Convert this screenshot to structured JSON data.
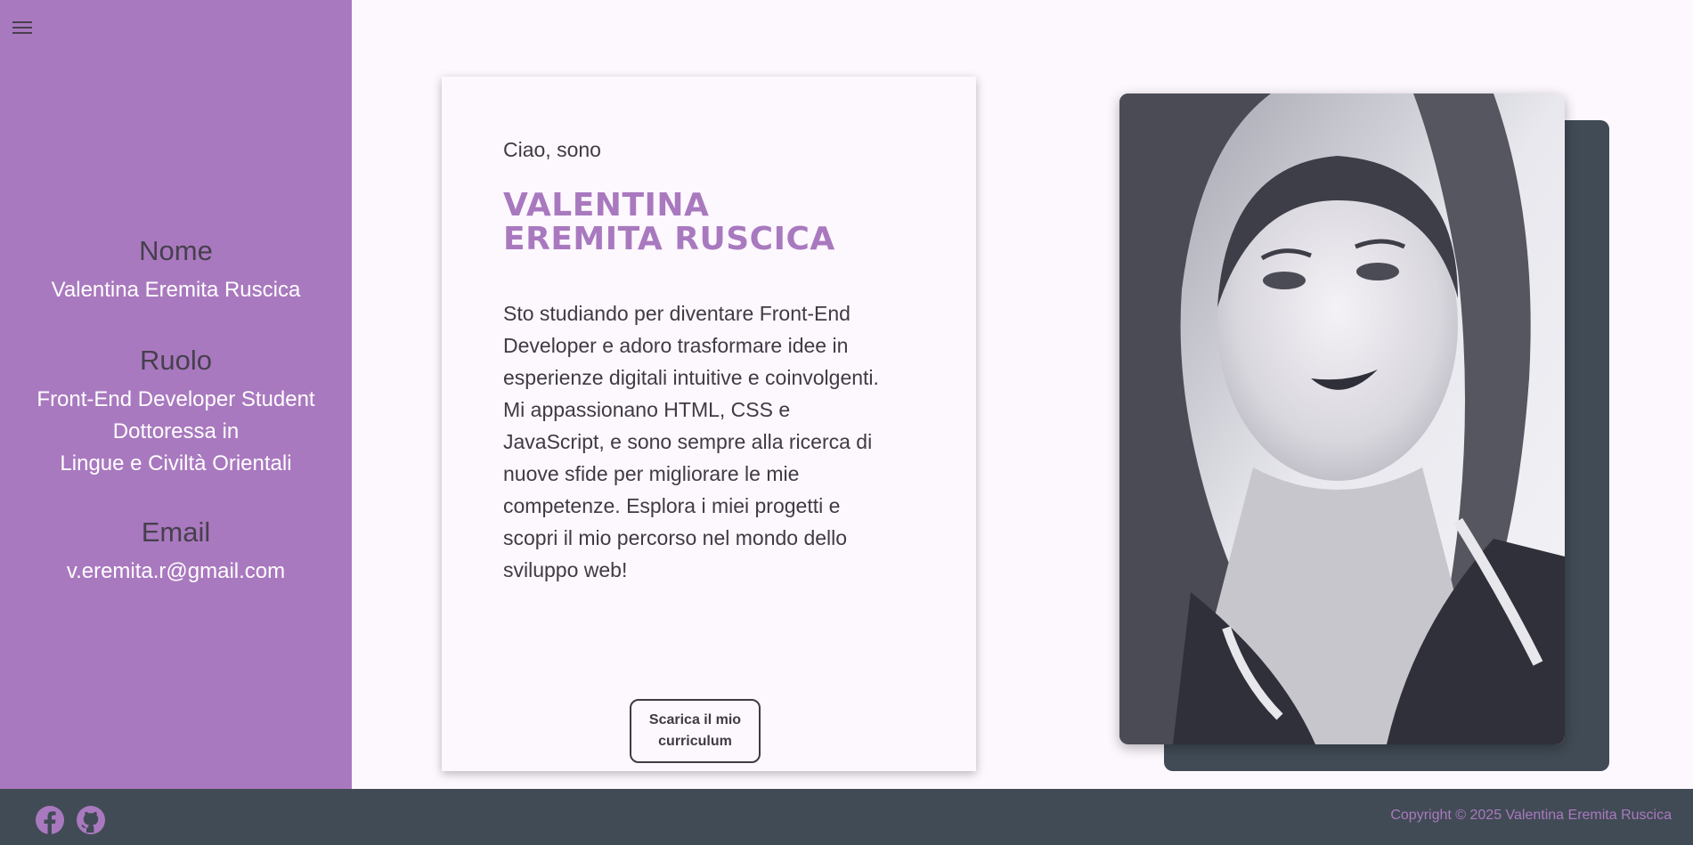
{
  "sidebar": {
    "menu_icon": "hamburger-menu-icon",
    "nome": {
      "title": "Nome",
      "value": "Valentina Eremita Ruscica"
    },
    "ruolo": {
      "title": "Ruolo",
      "lines": [
        "Front-End Developer Student",
        "Dottoressa in",
        "Lingue e Civiltà Orientali"
      ]
    },
    "email": {
      "title": "Email",
      "value": "v.eremita.r@gmail.com"
    }
  },
  "intro": {
    "greeting": "Ciao, sono",
    "name_line1": "VALENTINA",
    "name_line2": "EREMITA RUSCICA",
    "bio": "Sto studiando per diventare Front-End Developer e adoro trasformare idee in esperienze digitali intuitive e coinvolgenti. Mi appassionano HTML, CSS e JavaScript, e sono sempre alla ricerca di nuove sfide per migliorare le mie competenze. Esplora i miei progetti e scopri il mio percorso nel mondo dello sviluppo web!",
    "cv_button": "Scarica il mio curriculum"
  },
  "footer": {
    "social": [
      "facebook-icon",
      "github-icon"
    ],
    "copyright": "Copyright © 2025 Valentina Eremita Ruscica"
  },
  "colors": {
    "accent": "#a979bf",
    "dark": "#414b55",
    "background": "#fdf8fe"
  }
}
